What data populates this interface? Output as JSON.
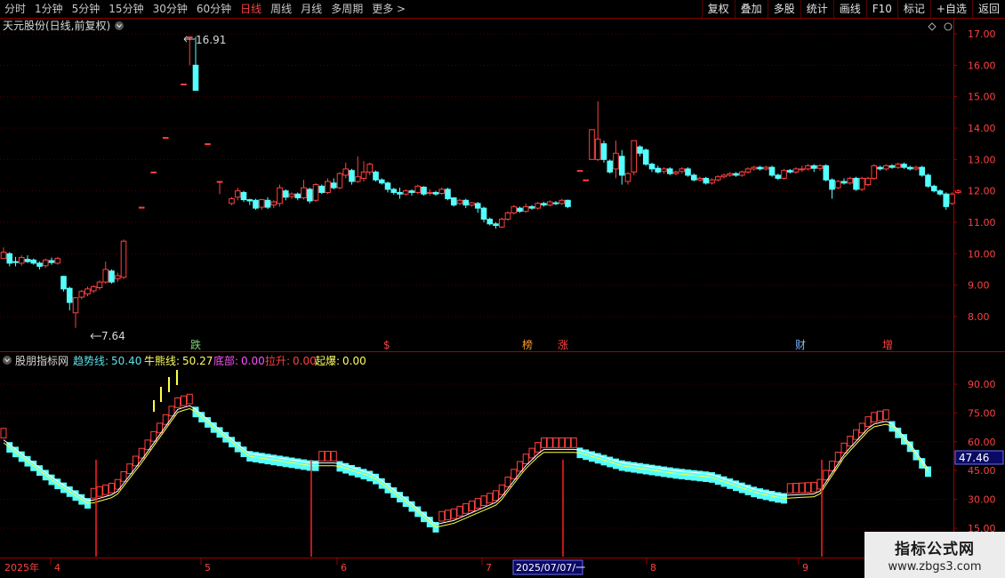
{
  "toolbar": {
    "tabs": [
      {
        "label": "分时",
        "active": false
      },
      {
        "label": "1分钟",
        "active": false
      },
      {
        "label": "5分钟",
        "active": false
      },
      {
        "label": "15分钟",
        "active": false
      },
      {
        "label": "30分钟",
        "active": false
      },
      {
        "label": "60分钟",
        "active": false
      },
      {
        "label": "日线",
        "active": true
      },
      {
        "label": "周线",
        "active": false
      },
      {
        "label": "月线",
        "active": false
      },
      {
        "label": "多周期",
        "active": false
      },
      {
        "label": "更多 >",
        "active": false
      }
    ],
    "tools": [
      "复权",
      "叠加",
      "多股",
      "统计",
      "画线",
      "F10",
      "标记",
      "+自选",
      "返回"
    ]
  },
  "main_panel": {
    "title": "天元股份(日线,前复权)",
    "high_label": "16.91",
    "low_label": "7.64",
    "price_ticks": [
      "17.00",
      "16.00",
      "15.00",
      "14.00",
      "13.00",
      "12.00",
      "11.00",
      "10.00",
      "9.00",
      "8.00"
    ],
    "event_markers": [
      {
        "text": "跌",
        "color": "#7cd47c"
      },
      {
        "text": "$",
        "color": "#ff4040"
      },
      {
        "text": "榜",
        "color": "#ff9a2a"
      },
      {
        "text": "涨",
        "color": "#ff4040"
      },
      {
        "text": "财",
        "color": "#7fb2ff"
      },
      {
        "text": "增",
        "color": "#ff4040"
      }
    ]
  },
  "indicator_panel": {
    "name": "股朋指标网",
    "items": [
      {
        "label": "趋势线:",
        "value": "50.40",
        "color": "#5fe0e8"
      },
      {
        "label": "牛熊线:",
        "value": "50.27",
        "color": "#ffff60"
      },
      {
        "label": "底部:",
        "value": "0.00",
        "color": "#ff50ff"
      },
      {
        "label": "拉升:",
        "value": "0.00",
        "color": "#ff4040"
      },
      {
        "label": "起爆:",
        "value": "0.00",
        "color": "#ffff60"
      }
    ],
    "ticks": [
      "90.00",
      "75.00",
      "60.00",
      "45.00",
      "30.00",
      "15.00"
    ],
    "current_value": "47.46"
  },
  "date_axis": {
    "labels": [
      "2025年",
      "4",
      "5",
      "6",
      "7",
      "8",
      "9"
    ],
    "cursor_date": "2025/07/07/一"
  },
  "watermark": {
    "title": "指标公式网",
    "url": "www.zbgs3.com"
  },
  "colors": {
    "up": "#ff4040",
    "down": "#54ffff",
    "grid": "#6a0000",
    "axis": "#a00000"
  },
  "chart_data": {
    "type": "candlestick",
    "ylim": [
      7.3,
      17.5
    ],
    "candles": [
      [
        9.85,
        10.05,
        9.95,
        10.2
      ],
      [
        10.0,
        9.7,
        9.6,
        10.05
      ],
      [
        9.75,
        9.72,
        9.6,
        9.9
      ],
      [
        9.7,
        9.88,
        9.62,
        9.95
      ],
      [
        9.82,
        9.75,
        9.7,
        9.95
      ],
      [
        9.8,
        9.7,
        9.65,
        9.85
      ],
      [
        9.7,
        9.6,
        9.5,
        9.75
      ],
      [
        9.62,
        9.8,
        9.55,
        9.85
      ],
      [
        9.78,
        9.72,
        9.65,
        9.88
      ],
      [
        9.7,
        9.85,
        9.65,
        9.9
      ],
      [
        9.28,
        8.88,
        8.8,
        9.3
      ],
      [
        8.9,
        8.45,
        8.2,
        8.95
      ],
      [
        8.12,
        8.6,
        7.64,
        8.62
      ],
      [
        8.62,
        8.8,
        8.55,
        8.85
      ],
      [
        8.72,
        8.88,
        8.65,
        8.95
      ],
      [
        8.82,
        8.95,
        8.75,
        9.0
      ],
      [
        8.92,
        9.1,
        8.85,
        9.15
      ],
      [
        9.1,
        9.5,
        9.05,
        9.75
      ],
      [
        9.45,
        9.1,
        9.05,
        9.5
      ],
      [
        9.2,
        9.3,
        9.1,
        9.4
      ],
      [
        9.25,
        10.4,
        9.2,
        10.45
      ],
      [
        null,
        null,
        null,
        null
      ],
      [
        null,
        null,
        null,
        null
      ],
      [
        11.48,
        11.48,
        11.48,
        11.48
      ],
      [
        null,
        null,
        null,
        null
      ],
      [
        12.6,
        12.6,
        12.6,
        12.6
      ],
      [
        null,
        null,
        null,
        null
      ],
      [
        13.7,
        13.7,
        13.7,
        13.7
      ],
      [
        null,
        null,
        null,
        null
      ],
      [
        null,
        null,
        null,
        null
      ],
      [
        15.4,
        15.4,
        15.4,
        15.4
      ],
      [
        16.9,
        16.9,
        16.0,
        16.91
      ],
      [
        16.0,
        15.2,
        15.2,
        16.9
      ],
      [
        null,
        null,
        null,
        null
      ],
      [
        13.5,
        13.5,
        13.5,
        13.5
      ],
      [
        null,
        null,
        null,
        null
      ],
      [
        12.3,
        12.3,
        11.9,
        12.3
      ],
      [
        null,
        null,
        null,
        null
      ],
      [
        11.6,
        11.75,
        11.55,
        11.8
      ],
      [
        11.8,
        12.0,
        11.7,
        12.1
      ],
      [
        11.95,
        11.72,
        11.65,
        12.0
      ],
      [
        11.72,
        11.68,
        11.55,
        11.75
      ],
      [
        11.7,
        11.45,
        11.4,
        11.75
      ],
      [
        11.48,
        11.72,
        11.4,
        11.75
      ],
      [
        11.7,
        11.48,
        11.42,
        11.8
      ],
      [
        11.55,
        11.65,
        11.45,
        11.7
      ],
      [
        11.6,
        12.1,
        11.5,
        12.2
      ],
      [
        12.0,
        11.8,
        11.7,
        12.05
      ],
      [
        11.82,
        11.9,
        11.75,
        11.95
      ],
      [
        11.9,
        11.78,
        11.7,
        11.95
      ],
      [
        11.78,
        12.1,
        11.72,
        12.35
      ],
      [
        12.05,
        11.68,
        11.6,
        12.1
      ],
      [
        11.7,
        12.2,
        11.65,
        12.25
      ],
      [
        12.15,
        11.95,
        11.9,
        12.2
      ],
      [
        11.95,
        12.3,
        11.9,
        12.4
      ],
      [
        12.25,
        12.1,
        12.05,
        12.4
      ],
      [
        12.1,
        12.55,
        12.05,
        12.6
      ],
      [
        12.5,
        12.7,
        12.4,
        12.9
      ],
      [
        12.65,
        12.3,
        12.2,
        12.7
      ],
      [
        12.3,
        12.45,
        12.25,
        13.1
      ],
      [
        12.4,
        12.6,
        12.3,
        12.95
      ],
      [
        12.6,
        12.85,
        12.5,
        12.9
      ],
      [
        12.6,
        12.35,
        12.3,
        12.65
      ],
      [
        12.35,
        12.25,
        12.2,
        12.4
      ],
      [
        12.25,
        12.05,
        11.95,
        12.3
      ],
      [
        12.05,
        11.95,
        11.88,
        12.1
      ],
      [
        11.95,
        11.9,
        11.75,
        12.1
      ],
      [
        11.9,
        12.0,
        11.85,
        12.05
      ],
      [
        12.0,
        11.95,
        11.85,
        12.05
      ],
      [
        11.95,
        12.15,
        11.9,
        12.2
      ],
      [
        12.12,
        11.9,
        11.85,
        12.15
      ],
      [
        11.92,
        11.95,
        11.85,
        12.05
      ],
      [
        11.95,
        11.9,
        11.85,
        12.0
      ],
      [
        11.92,
        12.05,
        11.88,
        12.1
      ],
      [
        12.05,
        11.75,
        11.7,
        12.1
      ],
      [
        11.78,
        11.55,
        11.5,
        11.8
      ],
      [
        11.6,
        11.7,
        11.55,
        11.75
      ],
      [
        11.7,
        11.55,
        11.45,
        11.75
      ],
      [
        11.55,
        11.62,
        11.5,
        11.65
      ],
      [
        11.6,
        11.45,
        11.3,
        11.65
      ],
      [
        11.45,
        11.1,
        11.0,
        11.5
      ],
      [
        11.1,
        10.95,
        10.9,
        11.15
      ],
      [
        10.95,
        10.9,
        10.8,
        11.0
      ],
      [
        10.85,
        11.1,
        10.82,
        11.15
      ],
      [
        11.1,
        11.3,
        11.05,
        11.35
      ],
      [
        11.3,
        11.5,
        11.25,
        11.55
      ],
      [
        11.45,
        11.35,
        11.3,
        11.5
      ],
      [
        11.35,
        11.5,
        11.3,
        11.6
      ],
      [
        11.5,
        11.45,
        11.4,
        11.55
      ],
      [
        11.45,
        11.6,
        11.4,
        11.65
      ],
      [
        11.6,
        11.55,
        11.5,
        11.65
      ],
      [
        11.55,
        11.65,
        11.5,
        11.7
      ],
      [
        11.62,
        11.6,
        11.55,
        11.68
      ],
      [
        11.6,
        11.7,
        11.55,
        11.75
      ],
      [
        11.7,
        11.5,
        11.45,
        11.72
      ],
      [
        null,
        null,
        null,
        null
      ],
      [
        12.65,
        12.65,
        12.65,
        12.65
      ],
      [
        12.35,
        12.35,
        12.35,
        12.35
      ],
      [
        13.0,
        13.95,
        13.0,
        13.95
      ],
      [
        13.0,
        13.65,
        12.95,
        14.85
      ],
      [
        13.5,
        13.0,
        12.9,
        13.6
      ],
      [
        12.95,
        12.6,
        12.55,
        13.0
      ],
      [
        12.7,
        13.2,
        12.4,
        13.6
      ],
      [
        13.1,
        12.5,
        12.2,
        13.3
      ],
      [
        12.3,
        12.55,
        12.2,
        12.6
      ],
      [
        12.6,
        13.6,
        12.5,
        13.6
      ],
      [
        13.4,
        13.2,
        13.1,
        13.45
      ],
      [
        13.3,
        12.85,
        12.8,
        13.35
      ],
      [
        12.85,
        12.7,
        12.6,
        12.9
      ],
      [
        12.72,
        12.6,
        12.55,
        12.8
      ],
      [
        12.62,
        12.7,
        12.55,
        12.75
      ],
      [
        12.7,
        12.55,
        12.5,
        12.75
      ],
      [
        12.55,
        12.6,
        12.5,
        12.65
      ],
      [
        12.62,
        12.7,
        12.55,
        12.75
      ],
      [
        12.7,
        12.5,
        12.45,
        12.75
      ],
      [
        12.5,
        12.35,
        12.3,
        12.55
      ],
      [
        12.35,
        12.4,
        12.3,
        12.45
      ],
      [
        12.4,
        12.25,
        12.2,
        12.45
      ],
      [
        12.25,
        12.35,
        12.2,
        12.4
      ],
      [
        12.35,
        12.45,
        12.3,
        12.5
      ],
      [
        12.45,
        12.5,
        12.4,
        12.55
      ],
      [
        12.5,
        12.55,
        12.45,
        12.6
      ],
      [
        12.55,
        12.5,
        12.45,
        12.6
      ],
      [
        12.5,
        12.6,
        12.45,
        12.65
      ],
      [
        12.6,
        12.7,
        12.55,
        12.75
      ],
      [
        12.7,
        12.75,
        12.65,
        12.8
      ],
      [
        12.75,
        12.7,
        12.65,
        12.8
      ],
      [
        12.7,
        12.75,
        12.65,
        12.8
      ],
      [
        12.75,
        12.5,
        12.45,
        12.8
      ],
      [
        12.5,
        12.4,
        12.35,
        12.55
      ],
      [
        12.4,
        12.65,
        12.35,
        12.7
      ],
      [
        12.65,
        12.6,
        12.55,
        12.7
      ],
      [
        12.6,
        12.7,
        12.55,
        12.75
      ],
      [
        12.7,
        12.7,
        12.6,
        12.8
      ],
      [
        12.7,
        12.8,
        12.65,
        12.85
      ],
      [
        12.8,
        12.72,
        12.6,
        12.85
      ],
      [
        12.72,
        12.8,
        12.65,
        12.85
      ],
      [
        12.8,
        12.35,
        12.3,
        12.85
      ],
      [
        12.35,
        12.05,
        11.75,
        12.4
      ],
      [
        12.1,
        12.3,
        12.05,
        12.35
      ],
      [
        12.3,
        12.25,
        12.2,
        12.4
      ],
      [
        12.25,
        12.4,
        12.2,
        12.45
      ],
      [
        12.4,
        12.05,
        12.0,
        12.45
      ],
      [
        12.05,
        12.4,
        12.0,
        12.45
      ],
      [
        12.2,
        12.4,
        12.15,
        12.45
      ],
      [
        12.4,
        12.8,
        12.35,
        12.85
      ],
      [
        12.75,
        12.7,
        12.65,
        12.8
      ],
      [
        12.7,
        12.8,
        12.65,
        12.85
      ],
      [
        12.8,
        12.75,
        12.7,
        12.85
      ],
      [
        12.75,
        12.85,
        12.7,
        12.9
      ],
      [
        12.85,
        12.75,
        12.7,
        12.9
      ],
      [
        12.75,
        12.7,
        12.65,
        12.8
      ],
      [
        12.7,
        12.75,
        12.65,
        12.8
      ],
      [
        12.75,
        12.5,
        12.45,
        12.8
      ],
      [
        12.5,
        12.15,
        12.1,
        12.55
      ],
      [
        12.15,
        12.0,
        11.95,
        12.2
      ],
      [
        12.0,
        11.9,
        11.85,
        12.05
      ],
      [
        11.9,
        11.5,
        11.4,
        11.95
      ],
      [
        11.6,
        11.9,
        11.55,
        11.95
      ],
      [
        11.95,
        12.0,
        11.9,
        12.05
      ]
    ]
  }
}
